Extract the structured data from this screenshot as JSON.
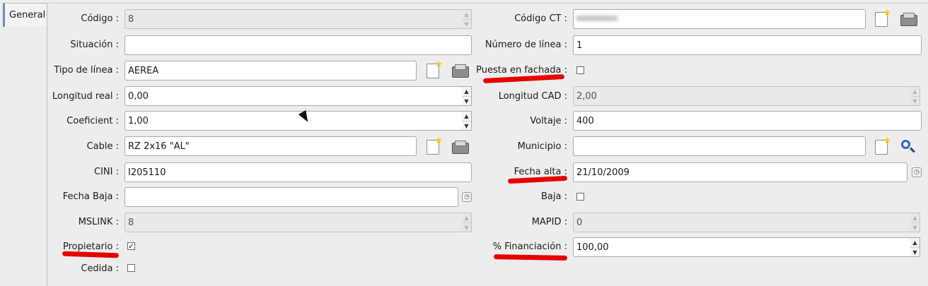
{
  "tabs": [
    {
      "label": "General"
    }
  ],
  "left": {
    "codigo": {
      "label": "Código :",
      "value": "8"
    },
    "situacion": {
      "label": "Situación :",
      "value": ""
    },
    "tipo_linea": {
      "label": "Tipo de línea :",
      "value": "AEREA"
    },
    "longitud_real": {
      "label": "Longitud real :",
      "value": "0,00"
    },
    "coeficient": {
      "label": "Coeficient :",
      "value": "1,00"
    },
    "cable": {
      "label": "Cable :",
      "value": "RZ 2x16 \"AL\""
    },
    "cini": {
      "label": "CINI :",
      "value": "I205110"
    },
    "fecha_baja": {
      "label": "Fecha Baja :",
      "value": ""
    },
    "mslink": {
      "label": "MSLINK :",
      "value": "8"
    },
    "propietario": {
      "label": "Propietario :",
      "checked": true
    },
    "cedida": {
      "label": "Cedida :",
      "checked": false
    }
  },
  "right": {
    "codigo_ct": {
      "label": "Código CT :",
      "value": ""
    },
    "numero_linea": {
      "label": "Número de línea :",
      "value": "1"
    },
    "puesta_fachada": {
      "label": "Puesta en fachada :",
      "checked": false
    },
    "longitud_cad": {
      "label": "Longitud CAD :",
      "value": "2,00"
    },
    "voltaje": {
      "label": "Voltaje :",
      "value": "400"
    },
    "municipio": {
      "label": "Municipio :",
      "value": ""
    },
    "fecha_alta": {
      "label": "Fecha alta :",
      "value": "21/10/2009"
    },
    "baja": {
      "label": "Baja :",
      "checked": false
    },
    "mapid": {
      "label": "MAPID :",
      "value": "0"
    },
    "financiacion": {
      "label": "% Financiación :",
      "value": "100,00"
    }
  },
  "icons": {
    "new": "new-document-icon",
    "open": "folder-icon",
    "search": "search-icon",
    "date": "calendar-icon",
    "spin_up": "▲",
    "spin_down": "▼",
    "check": "✓"
  },
  "colors": {
    "annotation": "#e60000",
    "tab_accent": "#6f8fc4"
  }
}
